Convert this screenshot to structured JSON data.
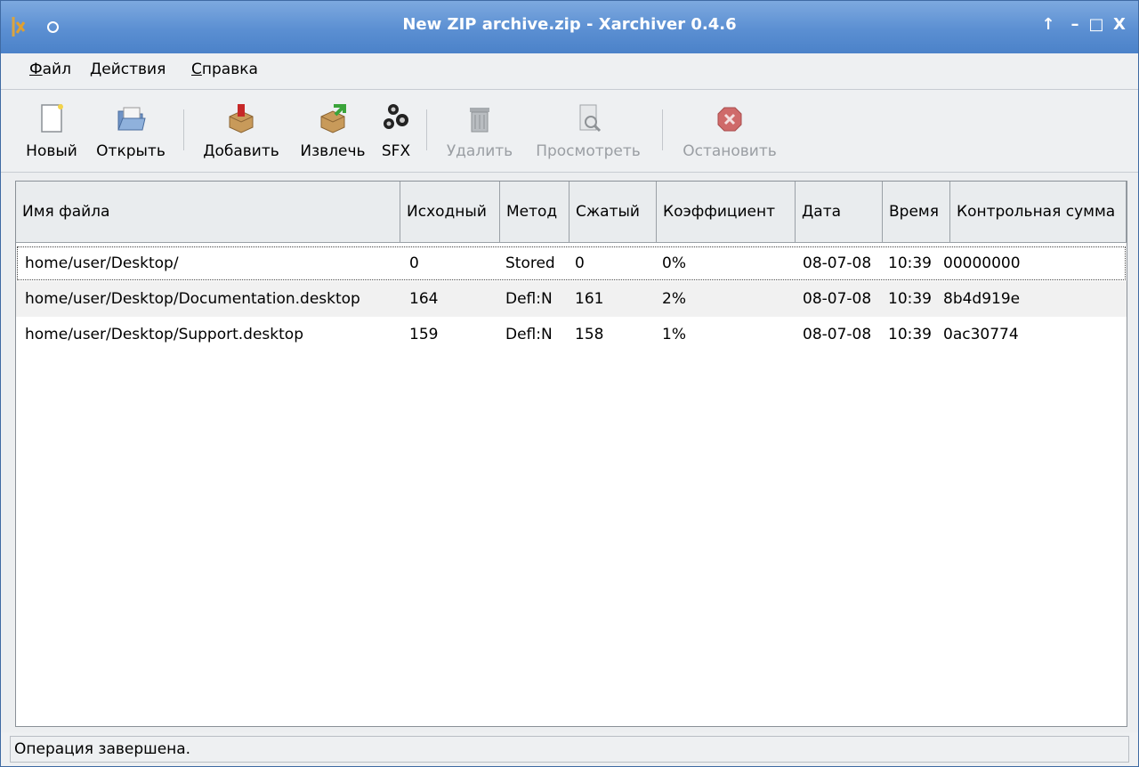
{
  "window": {
    "title": "New ZIP archive.zip - Xarchiver 0.4.6",
    "buttons": {
      "stick": "↑",
      "minimize": "–",
      "maximize": "□",
      "close": "X"
    }
  },
  "menubar": {
    "items": [
      {
        "accel": "Ф",
        "rest": "айл"
      },
      {
        "accel": "Д",
        "rest": "ействия"
      },
      {
        "accel": "С",
        "rest": "правка"
      }
    ]
  },
  "toolbar": {
    "new": "Новый",
    "open": "Открыть",
    "add": "Добавить",
    "extract": "Извлечь",
    "sfx": "SFX",
    "delete": "Удалить",
    "view": "Просмотреть",
    "stop": "Остановить"
  },
  "table": {
    "columns": [
      "Имя файла",
      "Исходный",
      "Метод",
      "Сжатый",
      "Коэффициент",
      "Дата",
      "Время",
      "Контрольная сумма"
    ],
    "rows": [
      [
        "home/user/Desktop/",
        "0",
        "Stored",
        "0",
        "0%",
        "08-07-08",
        "10:39",
        "00000000"
      ],
      [
        "home/user/Desktop/Documentation.desktop",
        "164",
        "Defl:N",
        "161",
        "2%",
        "08-07-08",
        "10:39",
        "8b4d919e"
      ],
      [
        "home/user/Desktop/Support.desktop",
        "159",
        "Defl:N",
        "158",
        "1%",
        "08-07-08",
        "10:39",
        "0ac30774"
      ]
    ]
  },
  "status": "Операция завершена.",
  "colors": {
    "titlebar": "#5b8fd2",
    "title_text": "#ffffff",
    "disabled_text": "#9a9ea3"
  }
}
